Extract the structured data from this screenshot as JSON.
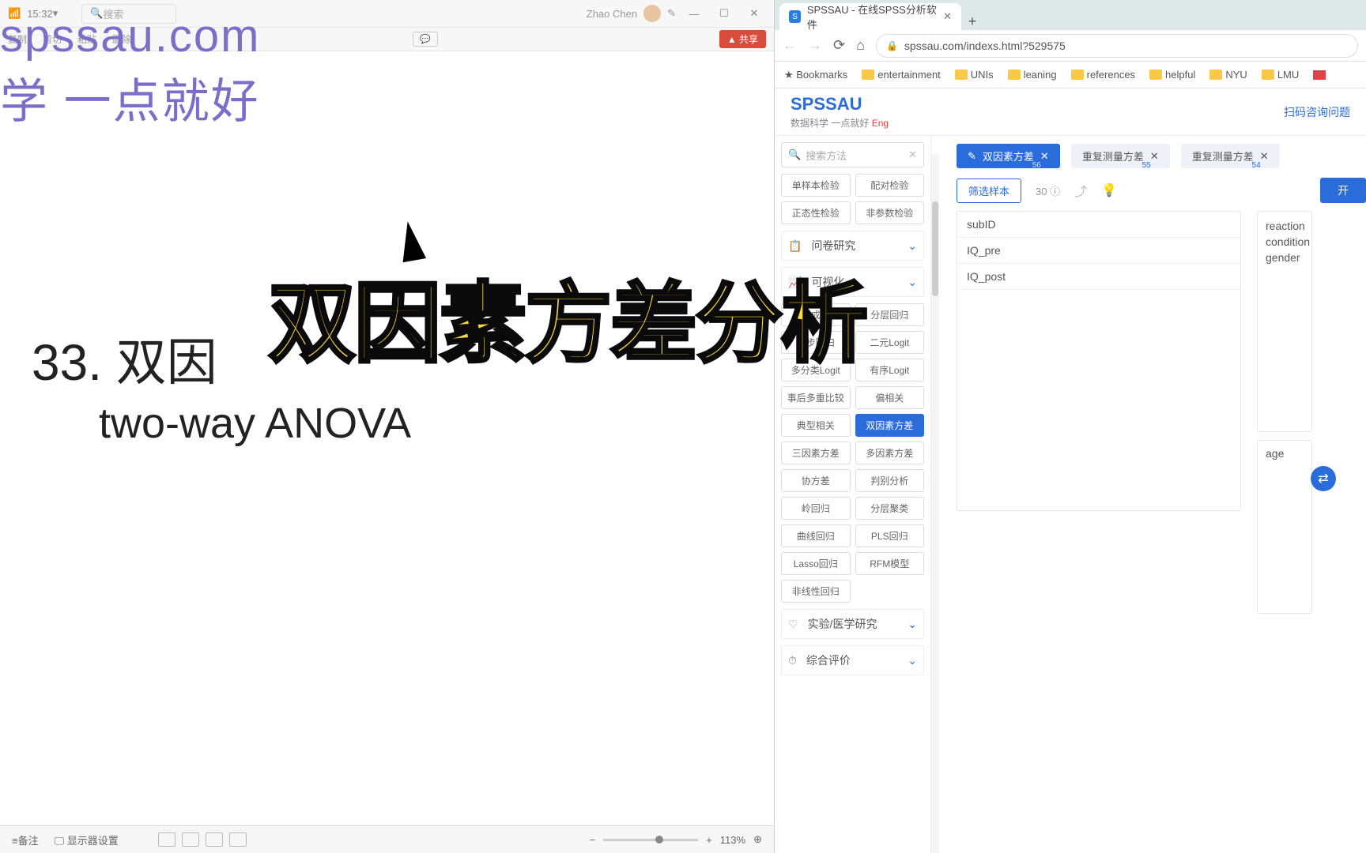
{
  "left": {
    "time": "15:32",
    "search_placeholder": "搜索",
    "user": "Zhao Chen",
    "menus": [
      "复制",
      "剪切",
      "粘贴",
      "删除"
    ],
    "chat": "💬",
    "share": "▲ 共享",
    "slide_num": "33.",
    "slide_title": "双因",
    "slide_sub": "two-way ANOVA",
    "status_notes": "≡备注",
    "status_display": "🖵 显示器设置",
    "zoom_pct": "113%"
  },
  "overlay": {
    "url": "spssau.com",
    "cn": "学 一点就好",
    "big": "双因素方差分析"
  },
  "browser": {
    "tab_title": "SPSSAU - 在线SPSS分析软件",
    "url": "spssau.com/indexs.html?529575",
    "bookmarks_star": "★ Bookmarks",
    "bookmarks": [
      "entertainment",
      "UNIs",
      "leaning",
      "references",
      "helpful",
      "NYU",
      "LMU"
    ]
  },
  "spssau": {
    "logo": "SPSSAU",
    "tagline": "数据科学 一点就好",
    "eng": "Eng",
    "headlink": "扫码咨询问题",
    "search_placeholder": "搜索方法",
    "top_tags": [
      [
        "单样本检验",
        "配对检验"
      ],
      [
        "正态性检验",
        "非参数检验"
      ]
    ],
    "cat_survey": "问卷研究",
    "cat_viz": "可视化",
    "method_rows": [
      [
        "主成分",
        "分层回归"
      ],
      [
        "逐步回归",
        "二元Logit"
      ],
      [
        "多分类Logit",
        "有序Logit"
      ],
      [
        "事后多重比较",
        "偏相关"
      ],
      [
        "典型相关",
        "双因素方差"
      ],
      [
        "三因素方差",
        "多因素方差"
      ],
      [
        "协方差",
        "判别分析"
      ],
      [
        "岭回归",
        "分层聚类"
      ],
      [
        "曲线回归",
        "PLS回归"
      ],
      [
        "Lasso回归",
        "RFM模型"
      ]
    ],
    "method_single": "非线性回归",
    "active_method": "双因素方差",
    "cat_exp": "实验/医学研究",
    "cat_eval": "综合评价",
    "tabs": [
      {
        "label": "双因素方差",
        "num": "56",
        "active": true
      },
      {
        "label": "重复测量方差",
        "num": "55",
        "active": false
      },
      {
        "label": "重复测量方差",
        "num": "54",
        "active": false
      }
    ],
    "filter": "筛选样本",
    "count": "30",
    "run": "开",
    "vars_left": [
      "subID",
      "IQ_pre",
      "IQ_post"
    ],
    "vars_right_top": [
      "reaction",
      "condition",
      "gender"
    ],
    "vars_right_bottom": [
      "age"
    ]
  }
}
